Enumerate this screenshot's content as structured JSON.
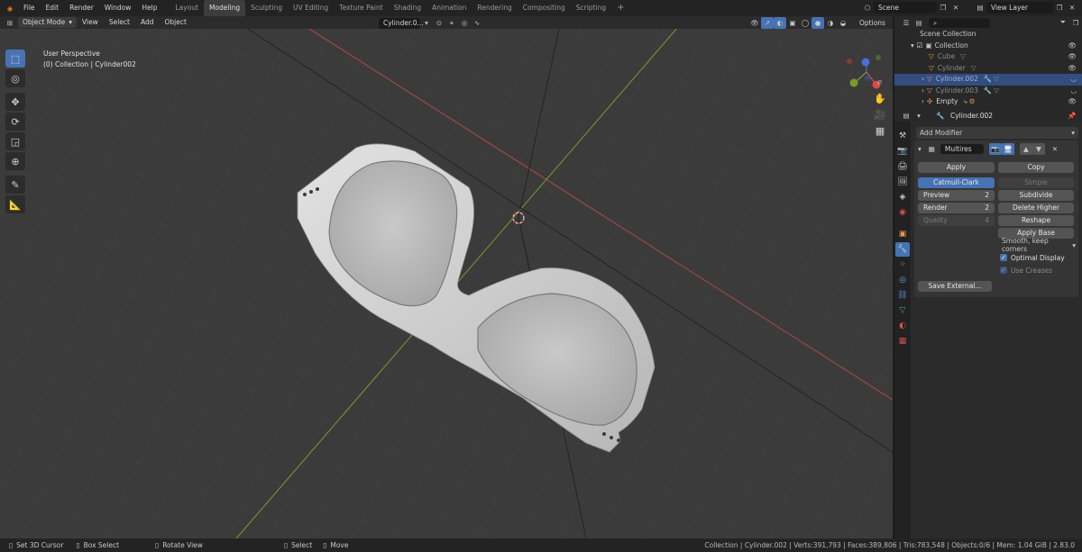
{
  "topbar": {
    "menus": [
      "File",
      "Edit",
      "Render",
      "Window",
      "Help"
    ],
    "workspaces": [
      "Layout",
      "Modeling",
      "Sculpting",
      "UV Editing",
      "Texture Paint",
      "Shading",
      "Animation",
      "Rendering",
      "Compositing",
      "Scripting"
    ],
    "active_workspace": "Modeling",
    "scene": "Scene",
    "view_layer": "View Layer"
  },
  "viewport_header": {
    "mode": "Object Mode",
    "menus": [
      "View",
      "Select",
      "Add",
      "Object"
    ],
    "active_object_field": "Cylinder.0...",
    "options": "Options"
  },
  "viewport": {
    "perspective_label": "User Perspective",
    "collection_label": "(0) Collection | Cylinder002",
    "gizmo_axes": [
      "X",
      "Y",
      "Z"
    ]
  },
  "outliner": {
    "root": "Scene Collection",
    "collection": "Collection",
    "items": [
      {
        "name": "Cube",
        "dim": true,
        "selected": false
      },
      {
        "name": "Cylinder",
        "dim": true,
        "selected": false
      },
      {
        "name": "Cylinder.002",
        "dim": false,
        "selected": true
      },
      {
        "name": "Cylinder.003",
        "dim": true,
        "selected": false
      },
      {
        "name": "Empty",
        "dim": false,
        "selected": false
      }
    ]
  },
  "properties": {
    "object_name": "Cylinder.002",
    "add_modifier": "Add Modifier",
    "modifier_name": "Multires",
    "apply": "Apply",
    "copy": "Copy",
    "catmull_clark": "Catmull-Clark",
    "simple": "Simple",
    "preview_label": "Preview",
    "preview_value": "2",
    "render_label": "Render",
    "render_value": "2",
    "quality_label": "Quality",
    "quality_value": "4",
    "subdivide": "Subdivide",
    "delete_higher": "Delete Higher",
    "reshape": "Reshape",
    "apply_base": "Apply Base",
    "uv_smooth": "Smooth, keep corners",
    "optimal_display": "Optimal Display",
    "use_creases": "Use Creases",
    "save_external": "Save External..."
  },
  "statusbar": {
    "items": [
      "Set 3D Cursor",
      "Box Select",
      "Rotate View",
      "Select",
      "Move"
    ],
    "stats": "Collection | Cylinder.002 | Verts:391,793 | Faces:389,806 | Tris:783,548 | Objects:0/6 | Mem: 1.04 GiB | 2.83.0"
  },
  "colors": {
    "accent": "#4772b3",
    "axis_x": "#c04848",
    "axis_y": "#7aa33a",
    "background": "#3a3a3a"
  }
}
